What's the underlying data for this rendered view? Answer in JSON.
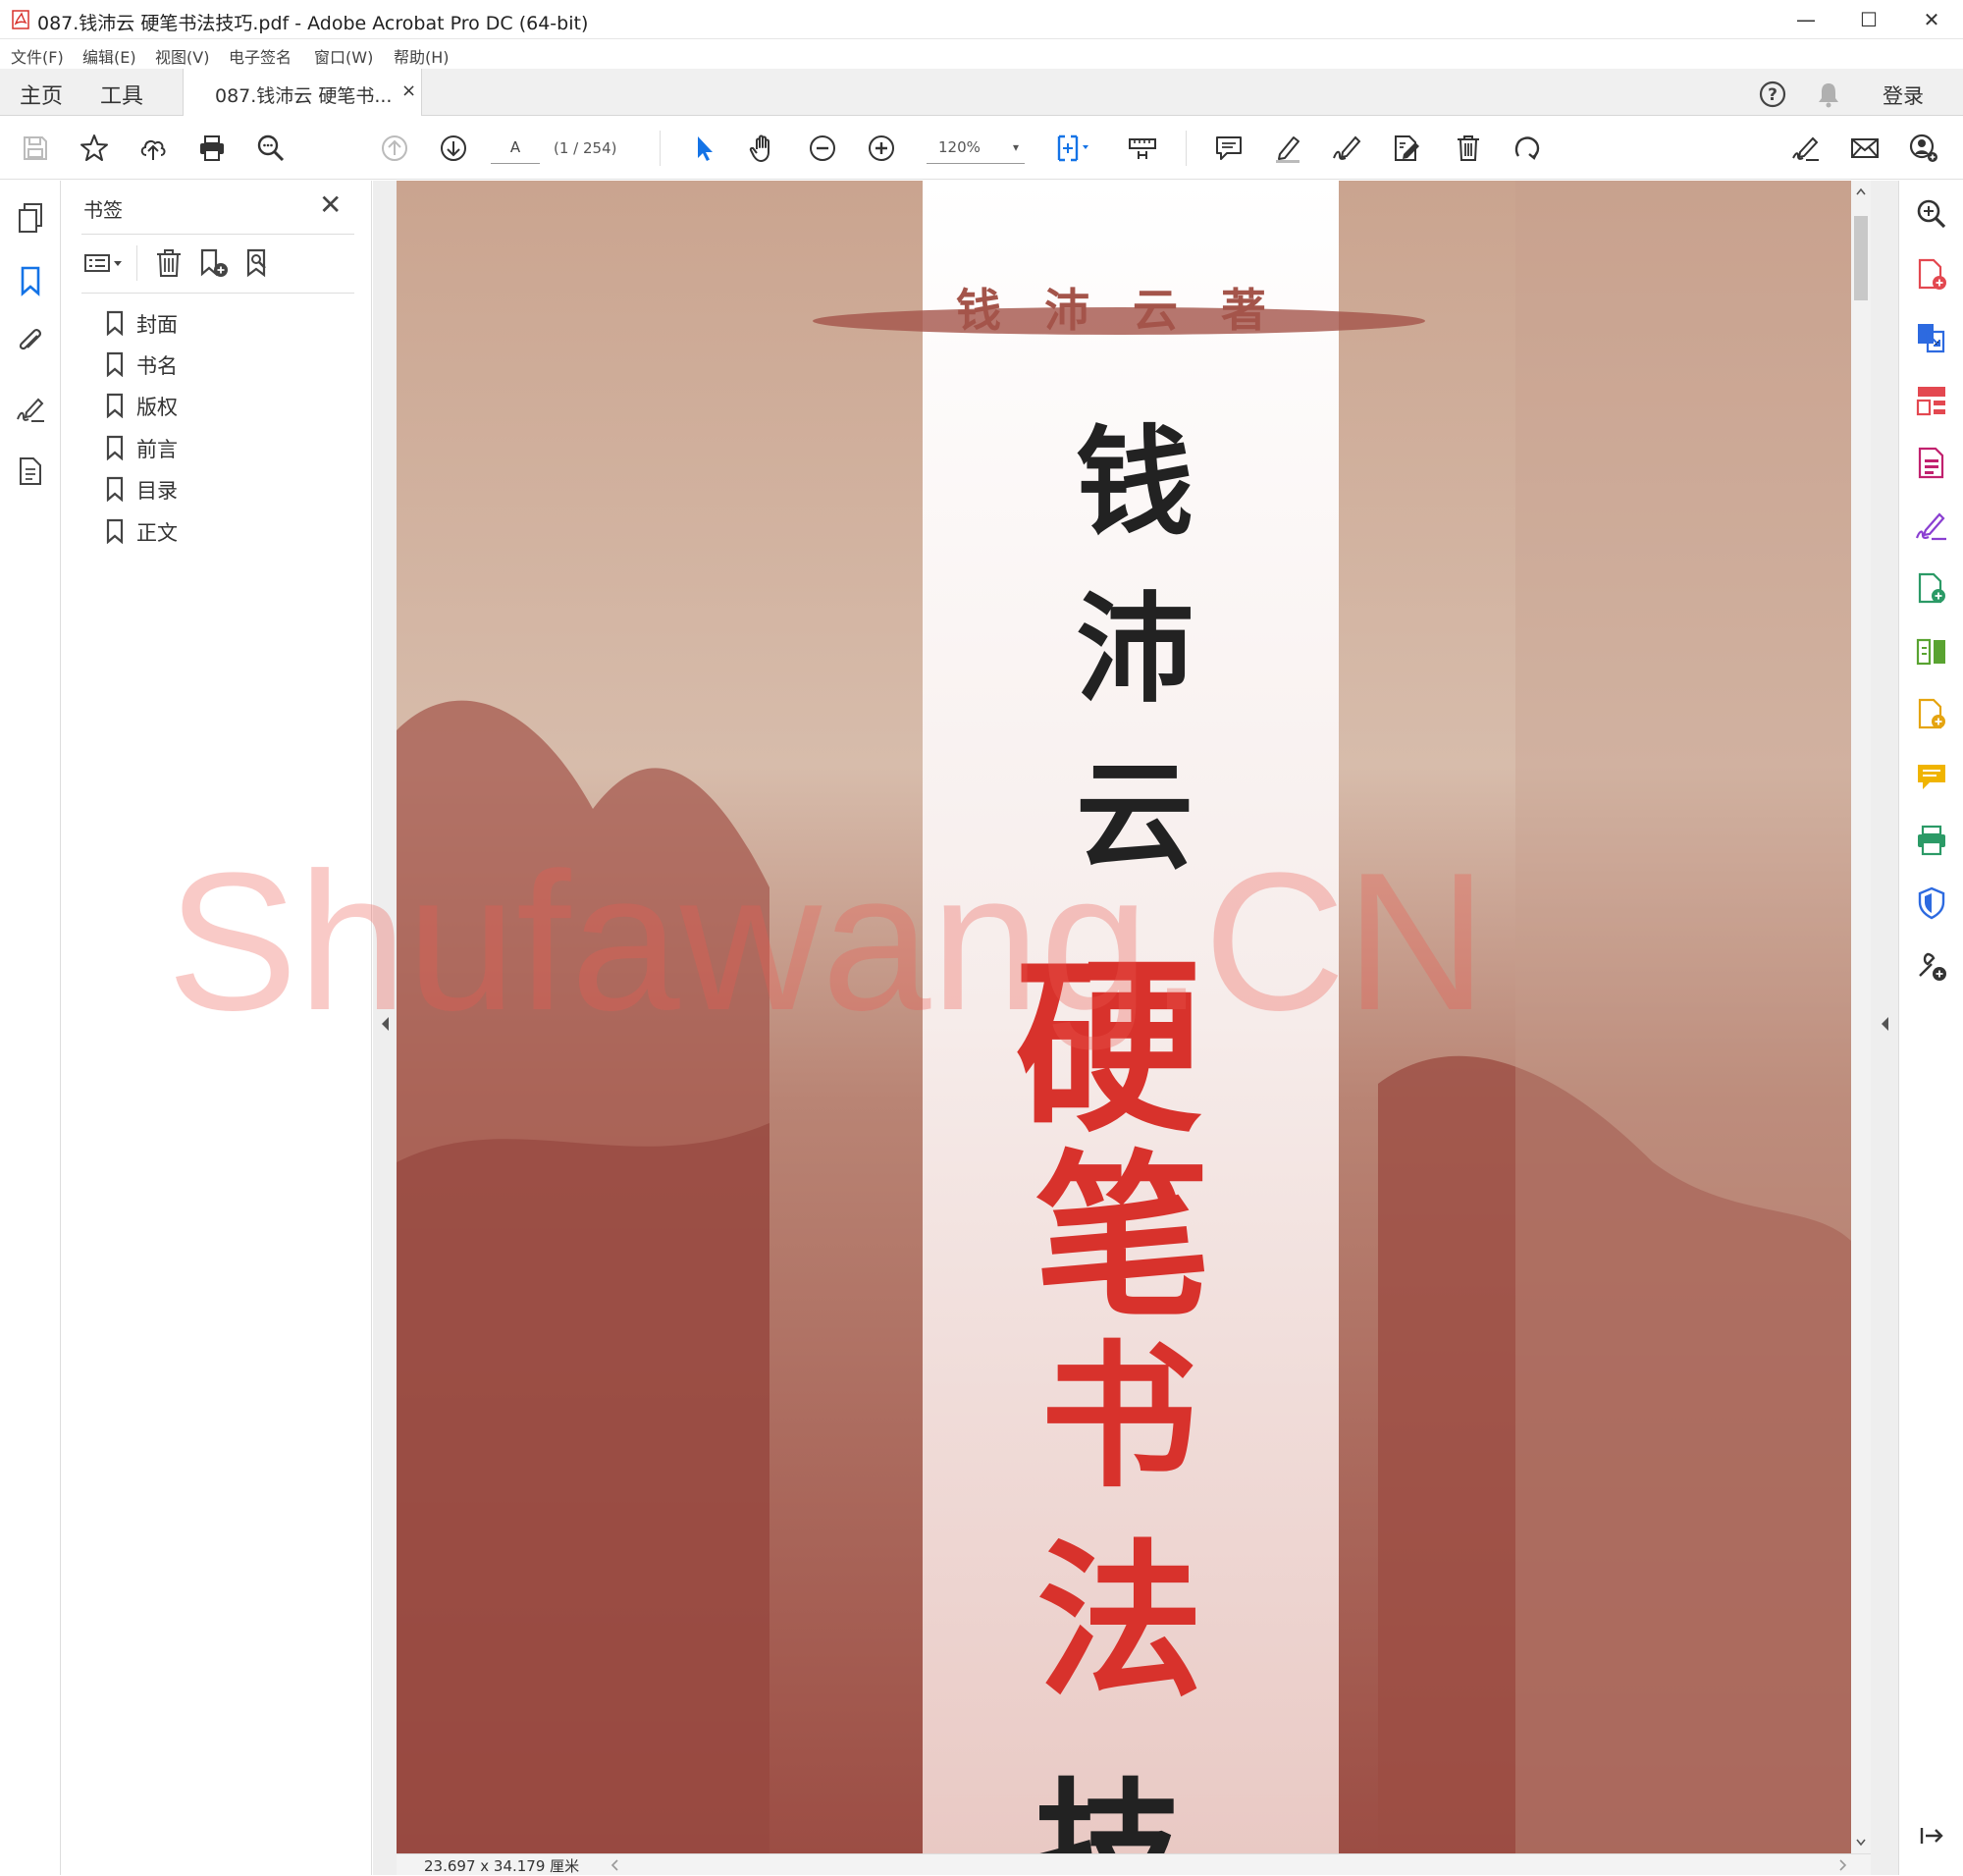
{
  "window": {
    "title": "087.钱沛云 硬笔书法技巧.pdf - Adobe Acrobat Pro DC (64-bit)",
    "minimize": "—",
    "maximize": "☐",
    "close": "✕"
  },
  "menu": {
    "items": [
      "文件(F)",
      "编辑(E)",
      "视图(V)",
      "电子签名",
      "窗口(W)",
      "帮助(H)"
    ]
  },
  "tabs": {
    "home": "主页",
    "tools": "工具",
    "document": "087.钱沛云 硬笔书...",
    "doc_close": "×",
    "login": "登录"
  },
  "toolbar": {
    "page_input": "A",
    "page_count": "(1 / 254)",
    "zoom": "120%",
    "zoom_arrow": "▾"
  },
  "bookmarks": {
    "header": "书签",
    "close": "✕",
    "items": [
      "封面",
      "书名",
      "版权",
      "前言",
      "目录",
      "正文"
    ]
  },
  "document": {
    "author_line": "钱 沛 云 著",
    "name_chars": [
      "钱",
      "沛",
      "云"
    ],
    "title_chars": [
      "硬",
      "笔",
      "书",
      "法",
      "技"
    ],
    "watermark": "Shufawang.CN"
  },
  "status": {
    "dimensions": "23.697 x 34.179 厘米"
  },
  "colors": {
    "accent": "#1473e6",
    "title_red": "#d8322c",
    "cover_brown": "#a4544a"
  }
}
